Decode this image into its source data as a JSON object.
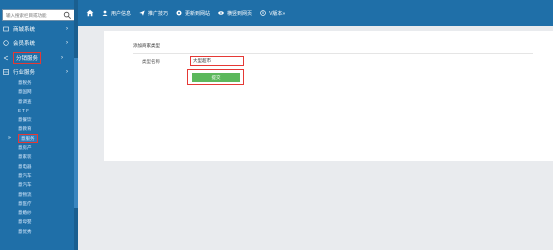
{
  "sidebar": {
    "search_placeholder": "输入搜索栏目或功能",
    "items": [
      {
        "label": "商城系统",
        "chevron": "›"
      },
      {
        "label": "会员系统",
        "chevron": "›"
      },
      {
        "label": "分销服务",
        "chevron": "›"
      },
      {
        "label": "行业服务",
        "chevron": "›"
      }
    ],
    "sub_items": [
      "意税务",
      "意国网",
      "意调查",
      "E T F",
      "意餐饮",
      "意教育",
      "意服务",
      "意房产",
      "意家装",
      "意电器",
      "意汽车",
      "意汽车",
      "意物流",
      "意医疗",
      "意婚纱",
      "意母婴",
      "意优秀"
    ],
    "current_arrow": "»"
  },
  "topnav": {
    "items": [
      "用户信息",
      "推广技巧",
      "更新到网站",
      "横竖到网页",
      "V版本»"
    ]
  },
  "form": {
    "title": "添加商家类型",
    "field_label": "类型名称",
    "field_value": "大型超市",
    "submit_label": "提交"
  },
  "colors": {
    "sidebar_bg": "#1f6fa8",
    "highlight_border": "#e53935",
    "submit_bg": "#5cb85c"
  }
}
